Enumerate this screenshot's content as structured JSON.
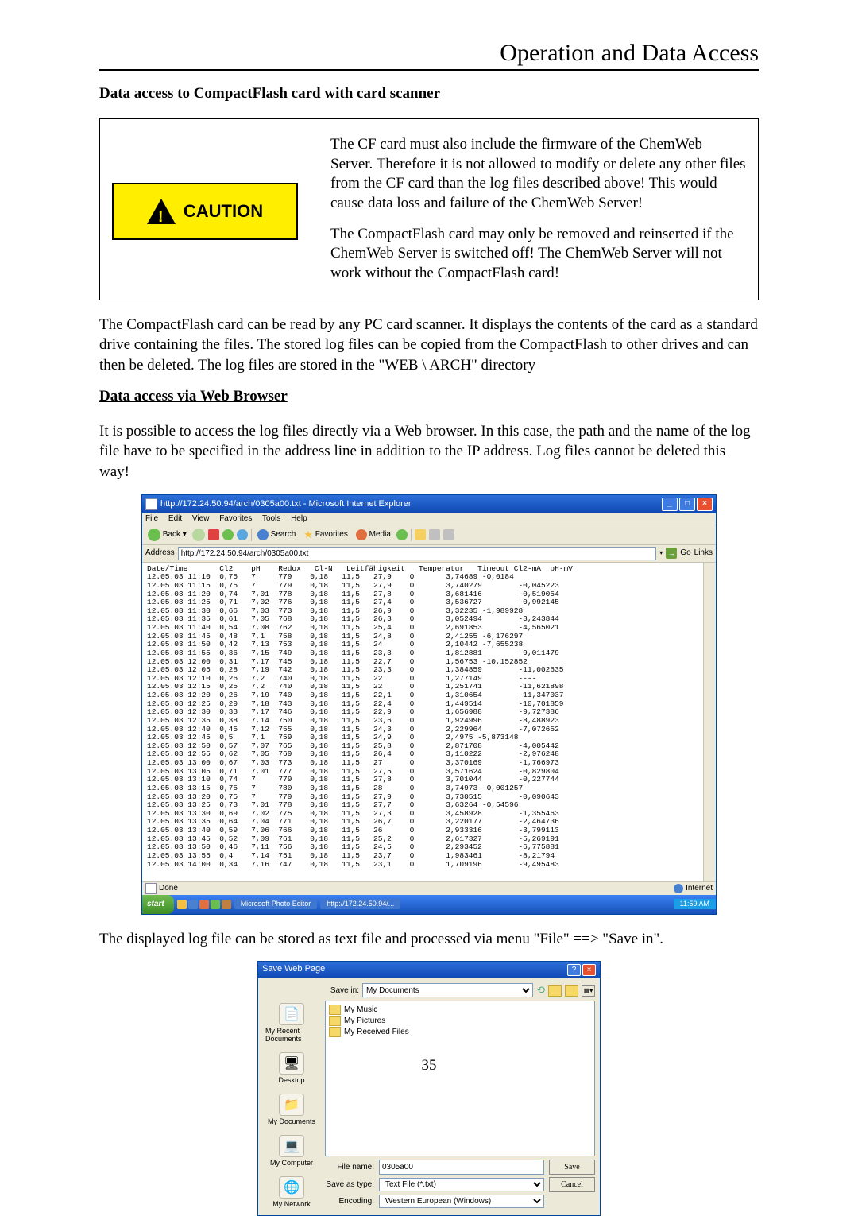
{
  "header": {
    "title": "Operation and Data Access"
  },
  "section1": {
    "title": "Data access to CompactFlash card with card scanner",
    "caution_label": "CAUTION",
    "caution_p1": "The CF card must also include the firmware of the ChemWeb Server. Therefore it is not allowed to modify or delete any other files from the CF card than the log files described above! This would cause data loss and failure of the ChemWeb Server!",
    "caution_p2": "The CompactFlash card may only be removed and reinserted if the ChemWeb Server is switched off! The ChemWeb Server will not work without the CompactFlash card!",
    "body": "The CompactFlash card can be read by any PC card scanner. It displays the contents of the card as a standard drive containing the files. The stored log files can be copied from the CompactFlash to other drives and can then be deleted. The log files are stored in the \"WEB \\ ARCH\" directory"
  },
  "section2": {
    "title": "Data access via Web Browser",
    "body": "It is possible to access the log files directly via a Web browser. In this case, the path and the name of the log file have to be specified in the address line in addition to the IP address. Log files cannot be deleted this way!"
  },
  "ie": {
    "title": "http://172.24.50.94/arch/0305a00.txt - Microsoft Internet Explorer",
    "menu": [
      "File",
      "Edit",
      "View",
      "Favorites",
      "Tools",
      "Help"
    ],
    "back": "Back",
    "search": "Search",
    "favorites": "Favorites",
    "media": "Media",
    "addr_label": "Address",
    "addr_value": "http://172.24.50.94/arch/0305a00.txt",
    "go": "Go",
    "links": "Links",
    "headers": "Date/Time       Cl2    pH    Redox   Cl-N   Leitfähigkeit   Temperatur   Timeout Cl2-mA  pH-mV",
    "rows": [
      "12.05.03 11:10  0,75   7     779    0,18   11,5   27,9    0       3,74689 -0,0184",
      "12.05.03 11:15  0,75   7     779    0,18   11,5   27,9    0       3,740279        -0,045223",
      "12.05.03 11:20  0,74   7,01  778    0,18   11,5   27,8    0       3,681416        -0,519054",
      "12.05.03 11:25  0,71   7,02  776    0,18   11,5   27,4    0       3,536727        -0,992145",
      "12.05.03 11:30  0,66   7,03  773    0,18   11,5   26,9    0       3,32235 -1,989928",
      "12.05.03 11:35  0,61   7,05  768    0,18   11,5   26,3    0       3,052494        -3,243844",
      "12.05.03 11:40  0,54   7,08  762    0,18   11,5   25,4    0       2,691853        -4,565021",
      "12.05.03 11:45  0,48   7,1   758    0,18   11,5   24,8    0       2,41255 -6,176297",
      "12.05.03 11:50  0,42   7,13  753    0,18   11,5   24      0       2,10442 -7,655238",
      "12.05.03 11:55  0,36   7,15  749    0,18   11,5   23,3    0       1,812881        -9,011479",
      "12.05.03 12:00  0,31   7,17  745    0,18   11,5   22,7    0       1,56753 -10,152852",
      "12.05.03 12:05  0,28   7,19  742    0,18   11,5   23,3    0       1,384859        -11,002635",
      "12.05.03 12:10  0,26   7,2   740    0,18   11,5   22      0       1,277149        ----",
      "12.05.03 12:15  0,25   7,2   740    0,18   11,5   22      0       1,251741        -11,621898",
      "12.05.03 12:20  0,26   7,19  740    0,18   11,5   22,1    0       1,310654        -11,347037",
      "12.05.03 12:25  0,29   7,18  743    0,18   11,5   22,4    0       1,449514        -10,701859",
      "12.05.03 12:30  0,33   7,17  746    0,18   11,5   22,9    0       1,656988        -9,727386",
      "12.05.03 12:35  0,38   7,14  750    0,18   11,5   23,6    0       1,924996        -8,488923",
      "12.05.03 12:40  0,45   7,12  755    0,18   11,5   24,3    0       2,229964        -7,072652",
      "12.05.03 12:45  0,5    7,1   759    0,18   11,5   24,9    0       2,4975 -5,873148",
      "12.05.03 12:50  0,57   7,07  765    0,18   11,5   25,8    0       2,871708        -4,005442",
      "12.05.03 12:55  0,62   7,05  769    0,18   11,5   26,4    0       3,110222        -2,976248",
      "12.05.03 13:00  0,67   7,03  773    0,18   11,5   27      0       3,370169        -1,766973",
      "12.05.03 13:05  0,71   7,01  777    0,18   11,5   27,5    0       3,571624        -0,829804",
      "12.05.03 13:10  0,74   7     779    0,18   11,5   27,8    0       3,701044        -0,227744",
      "12.05.03 13:15  0,75   7     780    0,18   11,5   28      0       3,74973 -0,001257",
      "12.05.03 13:20  0,75   7     779    0,18   11,5   27,9    0       3,730515        -0,090643",
      "12.05.03 13:25  0,73   7,01  778    0,18   11,5   27,7    0       3,63264 -0,54596",
      "12.05.03 13:30  0,69   7,02  775    0,18   11,5   27,3    0       3,458928        -1,355463",
      "12.05.03 13:35  0,64   7,04  771    0,18   11,5   26,7    0       3,220177        -2,464736",
      "12.05.03 13:40  0,59   7,06  766    0,18   11,5   26      0       2,933316        -3,799113",
      "12.05.03 13:45  0,52   7,09  761    0,18   11,5   25,2    0       2,617327        -5,269191",
      "12.05.03 13:50  0,46   7,11  756    0,18   11,5   24,5    0       2,293452        -6,775881",
      "12.05.03 13:55  0,4    7,14  751    0,18   11,5   23,7    0       1,983461        -8,21794",
      "12.05.03 14:00  0,34   7,16  747    0,18   11,5   23,1    0       1,709196        -9,495483"
    ],
    "status_done": "Done",
    "status_zone": "Internet",
    "start": "start",
    "task1": "Microsoft Photo Editor",
    "task2": "http://172.24.50.94/...",
    "clock": "11:59 AM"
  },
  "body3": "The displayed log file can be stored as text file and processed via menu \"File\" ==> \"Save in\".",
  "save": {
    "title": "Save Web Page",
    "savein_label": "Save in:",
    "savein_value": "My Documents",
    "places": {
      "recent": "My Recent Documents",
      "desktop": "Desktop",
      "mydocs": "My Documents",
      "mycomp": "My Computer",
      "mynet": "My Network"
    },
    "files": [
      "My Music",
      "My Pictures",
      "My Received Files"
    ],
    "filename_label": "File name:",
    "filename_value": "0305a00",
    "type_label": "Save as type:",
    "type_value": "Text File (*.txt)",
    "enc_label": "Encoding:",
    "enc_value": "Western European (Windows)",
    "save_btn": "Save",
    "cancel_btn": "Cancel"
  },
  "page_number": "35"
}
